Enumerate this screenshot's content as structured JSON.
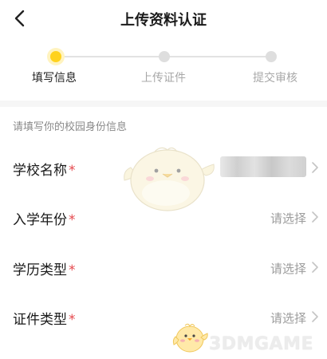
{
  "nav": {
    "title": "上传资料认证",
    "back_icon": "chevron-left-icon"
  },
  "steps": [
    {
      "label": "填写信息",
      "state": "active"
    },
    {
      "label": "上传证件",
      "state": "inactive"
    },
    {
      "label": "提交审核",
      "state": "inactive"
    }
  ],
  "colors": {
    "accent": "#ffd21e",
    "required": "#e5484d",
    "hint": "#8a8a8a"
  },
  "form": {
    "hint": "请填写你的校园身份信息",
    "fields": [
      {
        "label": "学校名称",
        "required_mark": "*",
        "value": "",
        "value_state": "blurred"
      },
      {
        "label": "入学年份",
        "required_mark": "*",
        "value": "请选择"
      },
      {
        "label": "学历类型",
        "required_mark": "*",
        "value": "请选择"
      },
      {
        "label": "证件类型",
        "required_mark": "*",
        "value": "请选择"
      }
    ]
  },
  "watermark": {
    "text": "3DMGAME"
  }
}
